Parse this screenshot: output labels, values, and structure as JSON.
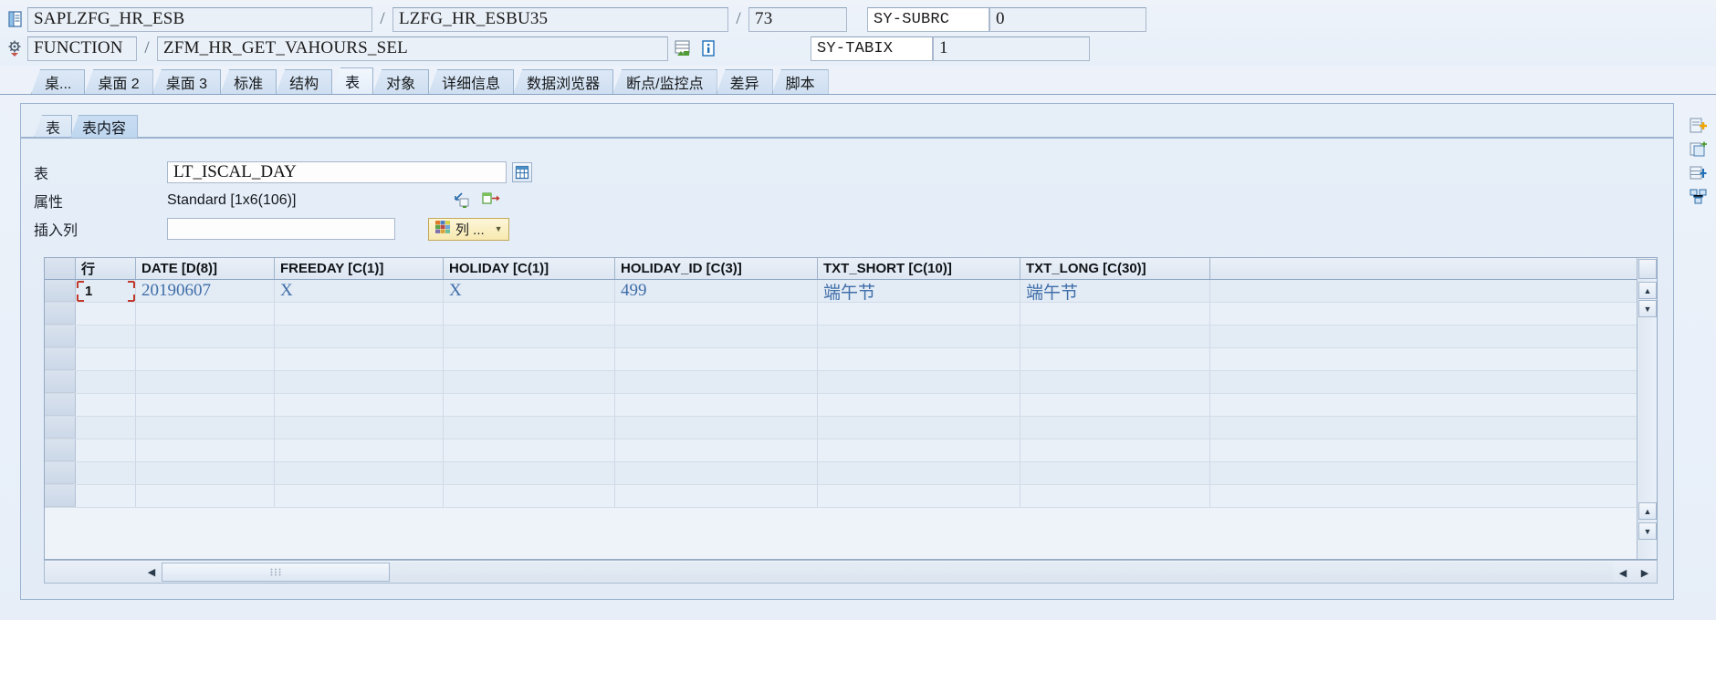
{
  "header": {
    "program": "SAPLZFG_HR_ESB",
    "include": "LZFG_HR_ESBU35",
    "line": "73",
    "sy_subrc_label": "SY-SUBRC",
    "sy_subrc_value": "0",
    "event_type": "FUNCTION",
    "event_name": "ZFM_HR_GET_VAHOURS_SEL",
    "sy_tabix_label": "SY-TABIX",
    "sy_tabix_value": "1",
    "sep": "/",
    "icons": {
      "program": "program-icon",
      "event": "settings-icon",
      "stack": "call-stack-icon",
      "info": "info-icon"
    }
  },
  "tabs": [
    {
      "label": "桌...",
      "active": false
    },
    {
      "label": "桌面 2",
      "active": false
    },
    {
      "label": "桌面 3",
      "active": false
    },
    {
      "label": "标准",
      "active": false
    },
    {
      "label": "结构",
      "active": false
    },
    {
      "label": "表",
      "active": true
    },
    {
      "label": "对象",
      "active": false
    },
    {
      "label": "详细信息",
      "active": false
    },
    {
      "label": "数据浏览器",
      "active": false
    },
    {
      "label": "断点/监控点",
      "active": false
    },
    {
      "label": "差异",
      "active": false
    },
    {
      "label": "脚本",
      "active": false
    }
  ],
  "subtabs": [
    {
      "label": "表",
      "active": false
    },
    {
      "label": "表内容",
      "active": true
    }
  ],
  "form": {
    "table_label": "表",
    "table_value": "LT_ISCAL_DAY",
    "attr_label": "属性",
    "attr_value": "Standard [1x6(106)]",
    "insert_label": "插入列",
    "insert_value": "",
    "columns_button": "列 ...",
    "icons": {
      "table_picker": "table-picker-icon",
      "resize": "resize-icon",
      "export": "export-icon",
      "columns": "columns-grid-icon"
    }
  },
  "grid": {
    "columns": [
      "行",
      "DATE [D(8)]",
      "FREEDAY [C(1)]",
      "HOLIDAY [C(1)]",
      "HOLIDAY_ID [C(3)]",
      "TXT_SHORT [C(10)]",
      "TXT_LONG [C(30)]"
    ],
    "rows": [
      {
        "num": "1",
        "DATE": "20190607",
        "FREEDAY": "X",
        "HOLIDAY": "X",
        "HOLIDAY_ID": "499",
        "TXT_SHORT": "端午节",
        "TXT_LONG": "端午节"
      }
    ],
    "empty_row_count": 8
  },
  "scrollbars": {
    "up_arrow": "▲",
    "down_arrow": "▼",
    "left_arrow": "◀",
    "right_arrow": "▶"
  },
  "rail": [
    {
      "name": "new-entry-icon"
    },
    {
      "name": "copy-row-icon"
    },
    {
      "name": "insert-row-icon"
    },
    {
      "name": "structure-icon"
    }
  ],
  "colors": {
    "accent": "#3f6ea8",
    "header_border": "#8aa4c4",
    "panel_bg": "#e6eef8",
    "value_text": "#3f6ea8"
  }
}
